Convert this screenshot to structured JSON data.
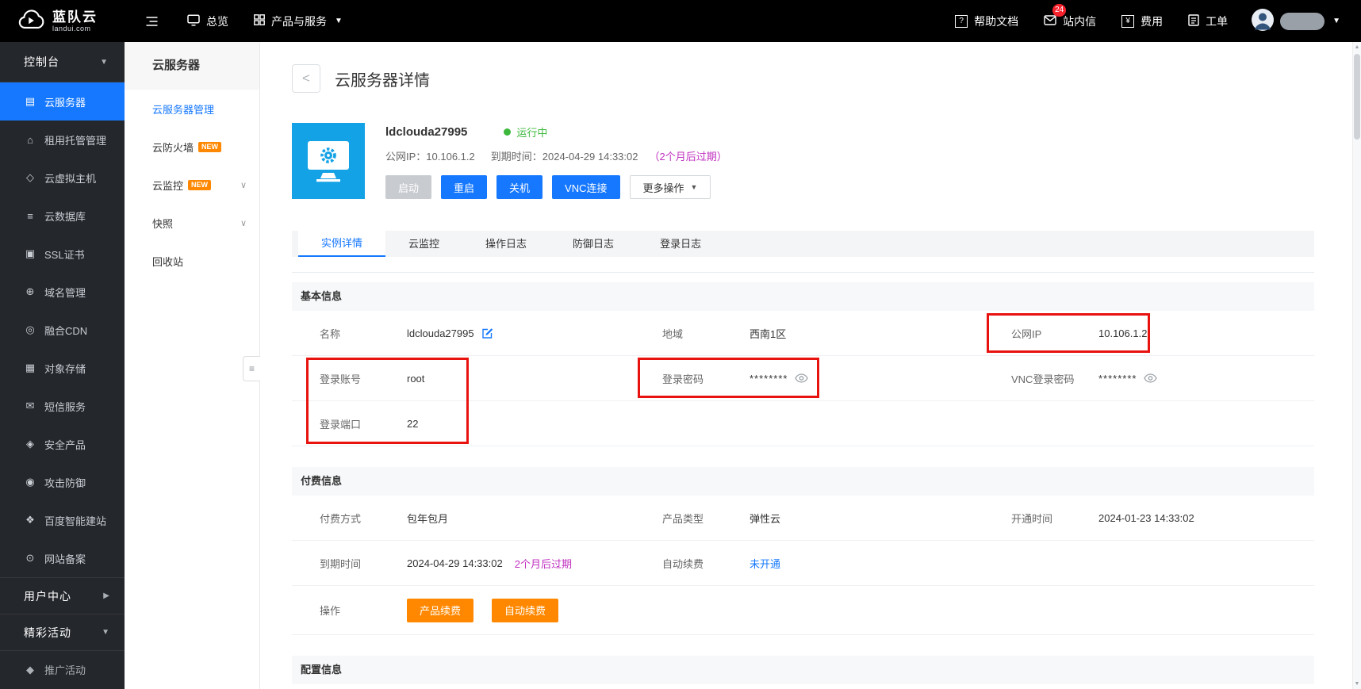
{
  "navbar": {
    "logo": {
      "title": "蓝队云",
      "subtitle": "landui.com"
    },
    "overview": "总览",
    "products": "产品与服务",
    "help": "帮助文档",
    "messages": "站内信",
    "messages_badge": "24",
    "billing": "费用",
    "tickets": "工单"
  },
  "sidebar": {
    "console_label": "控制台",
    "items": [
      {
        "label": "云服务器"
      },
      {
        "label": "租用托管管理"
      },
      {
        "label": "云虚拟主机"
      },
      {
        "label": "云数据库"
      },
      {
        "label": "SSL证书"
      },
      {
        "label": "域名管理"
      },
      {
        "label": "融合CDN"
      },
      {
        "label": "对象存储"
      },
      {
        "label": "短信服务"
      },
      {
        "label": "安全产品"
      },
      {
        "label": "攻击防御"
      },
      {
        "label": "百度智能建站"
      },
      {
        "label": "网站备案"
      }
    ],
    "user_center": "用户中心",
    "activities": "精彩活动",
    "promotion": "推广活动"
  },
  "submenu": {
    "title": "云服务器",
    "items": [
      {
        "label": "云服务器管理"
      },
      {
        "label": "云防火墙",
        "badge": "NEW"
      },
      {
        "label": "云监控",
        "badge": "NEW"
      },
      {
        "label": "快照"
      },
      {
        "label": "回收站"
      }
    ]
  },
  "page": {
    "title": "云服务器详情",
    "server": {
      "name": "ldclouda27995",
      "status": "运行中",
      "ip_label": "公网IP：",
      "ip_value": "10.106.1.2",
      "expire_label": "到期时间：",
      "expire_value": "2024-04-29 14:33:02",
      "expire_warning": "（2个月后过期）",
      "btn_start": "启动",
      "btn_restart": "重启",
      "btn_shutdown": "关机",
      "btn_vnc": "VNC连接",
      "btn_more": "更多操作"
    },
    "tabs": [
      {
        "label": "实例详情"
      },
      {
        "label": "云监控"
      },
      {
        "label": "操作日志"
      },
      {
        "label": "防御日志"
      },
      {
        "label": "登录日志"
      }
    ],
    "basic": {
      "title": "基本信息",
      "name_label": "名称",
      "name_value": "ldclouda27995",
      "region_label": "地域",
      "region_value": "西南1区",
      "ip_label": "公网IP",
      "ip_value": "10.106.1.2",
      "account_label": "登录账号",
      "account_value": "root",
      "password_label": "登录密码",
      "password_value": "********",
      "vnc_label": "VNC登录密码",
      "vnc_value": "********",
      "port_label": "登录端口",
      "port_value": "22"
    },
    "payment": {
      "title": "付费信息",
      "method_label": "付费方式",
      "method_value": "包年包月",
      "type_label": "产品类型",
      "type_value": "弹性云",
      "open_label": "开通时间",
      "open_value": "2024-01-23 14:33:02",
      "expire_label": "到期时间",
      "expire_value": "2024-04-29 14:33:02",
      "expire_warning": "2个月后过期",
      "renew_label": "自动续费",
      "renew_value": "未开通",
      "action_label": "操作",
      "btn_renew_product": "产品续费",
      "btn_renew_auto": "自动续费"
    },
    "config": {
      "title": "配置信息"
    }
  },
  "colors": {
    "accent_blue": "#1678ff",
    "icon_blue": "#14a2e6",
    "status_green": "#3cb83c",
    "warning_magenta": "#c030c0",
    "button_orange": "#ff8800",
    "badge_red": "#f5222d",
    "annotation_red": "#e8120f",
    "navbar_black": "#000000",
    "sidebar_dark": "#24272c"
  }
}
